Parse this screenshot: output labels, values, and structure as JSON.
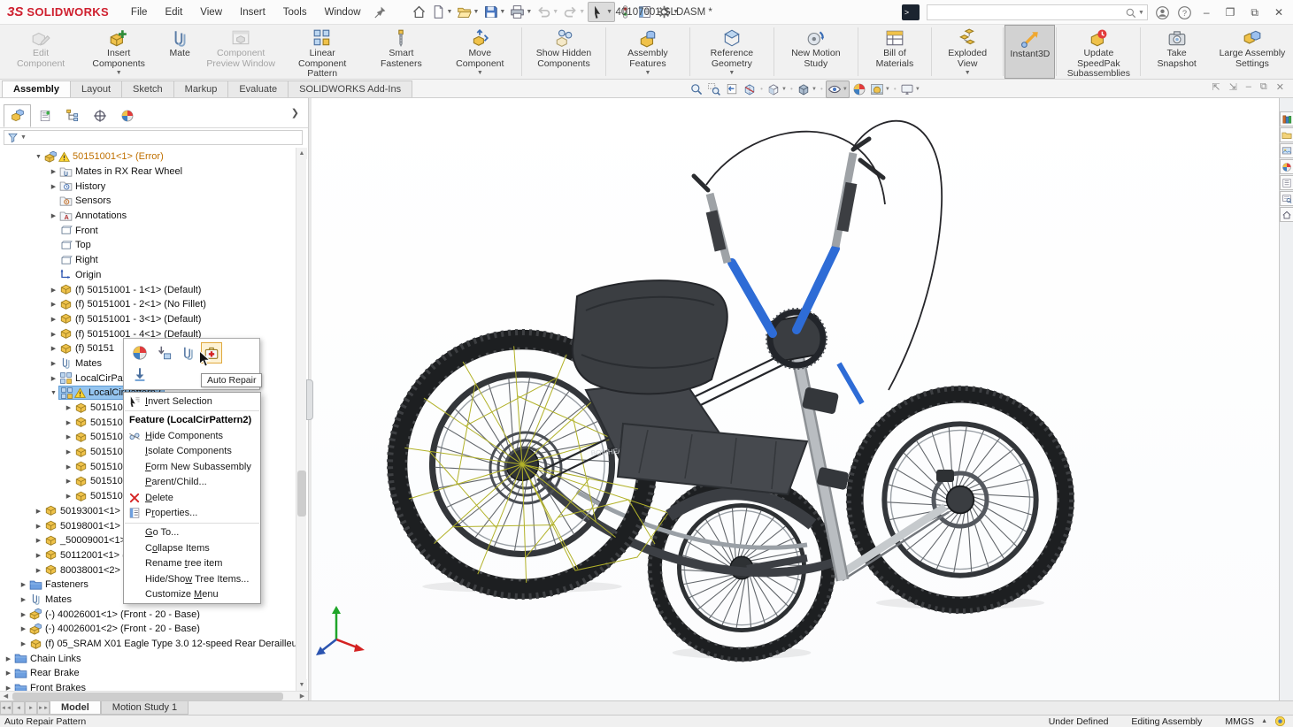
{
  "title_bar": {
    "brand_prefix": "3S",
    "brand": "SOLIDWORKS",
    "menus": [
      "File",
      "Edit",
      "View",
      "Insert",
      "Tools",
      "Window"
    ],
    "quick_access": [
      {
        "name": "home",
        "icon": "home"
      },
      {
        "name": "new-document",
        "icon": "new-doc",
        "caret": true
      },
      {
        "name": "open",
        "icon": "open",
        "caret": true
      },
      {
        "name": "save",
        "icon": "save",
        "caret": true
      },
      {
        "name": "print",
        "icon": "print",
        "caret": true
      },
      {
        "name": "undo",
        "icon": "undo",
        "caret": true,
        "disabled": true
      },
      {
        "name": "redo",
        "icon": "redo",
        "caret": true,
        "disabled": true
      },
      {
        "name": "select",
        "icon": "cursor",
        "caret": true,
        "active": true
      },
      {
        "name": "selection-filter",
        "icon": "pill"
      },
      {
        "name": "task-pane-list",
        "icon": "tasklist"
      },
      {
        "name": "options",
        "icon": "gear",
        "caret": true
      }
    ],
    "document_title": "40107001.SLDASM *",
    "search_placeholder": ""
  },
  "ribbon": {
    "buttons": [
      {
        "label": "Edit Component",
        "icon": "edit-component",
        "disabled": true
      },
      {
        "label": "Insert Components",
        "icon": "insert-components",
        "caret": true
      },
      {
        "label": "Mate",
        "icon": "mate"
      },
      {
        "label": "Component Preview Window",
        "icon": "component-preview",
        "disabled": true
      },
      {
        "label": "Linear Component Pattern",
        "icon": "linear-pattern",
        "caret": true
      },
      {
        "label": "Smart Fasteners",
        "icon": "smart-fasteners"
      },
      {
        "label": "Move Component",
        "icon": "move-component",
        "caret": true
      },
      {
        "label": "Show Hidden Components",
        "icon": "show-hidden",
        "divider": true
      },
      {
        "label": "Assembly Features",
        "icon": "assembly-features",
        "caret": true,
        "divider": true
      },
      {
        "label": "Reference Geometry",
        "icon": "reference-geometry",
        "caret": true,
        "divider": true
      },
      {
        "label": "New Motion Study",
        "icon": "motion-study",
        "divider": true
      },
      {
        "label": "Bill of Materials",
        "icon": "bom",
        "divider": true
      },
      {
        "label": "Exploded View",
        "icon": "exploded-view",
        "caret": true,
        "divider": true
      },
      {
        "label": "Instant3D",
        "icon": "instant3d",
        "active": true,
        "divider": true
      },
      {
        "label": "Update SpeedPak Subassemblies",
        "icon": "speedpak",
        "divider": true
      },
      {
        "label": "Take Snapshot",
        "icon": "snapshot",
        "divider": true
      },
      {
        "label": "Large Assembly Settings",
        "icon": "large-assembly"
      }
    ]
  },
  "command_tabs": {
    "items": [
      "Assembly",
      "Layout",
      "Sketch",
      "Markup",
      "Evaluate",
      "SOLIDWORKS Add-Ins"
    ],
    "active": "Assembly"
  },
  "headsup": {
    "icons": [
      {
        "name": "zoom-to-fit",
        "icon": "zoom-fit"
      },
      {
        "name": "zoom-to-area",
        "icon": "zoom-area"
      },
      {
        "name": "previous-view",
        "icon": "prev-view"
      },
      {
        "name": "section-view",
        "icon": "section"
      },
      {
        "name": "view-orientation",
        "icon": "orientation",
        "caret": true,
        "divider": true
      },
      {
        "name": "display-style",
        "icon": "display-style",
        "caret": true,
        "divider": true
      },
      {
        "name": "hide-show-items",
        "icon": "eye",
        "caret": true,
        "active": true,
        "divider": true
      },
      {
        "name": "edit-appearance",
        "icon": "ball"
      },
      {
        "name": "apply-scene",
        "icon": "scene",
        "caret": true
      },
      {
        "name": "view-settings",
        "icon": "monitor",
        "caret": true,
        "divider": true
      }
    ]
  },
  "doc_controls": [
    "pane-previous",
    "pane-next",
    "minimize",
    "restore",
    "close"
  ],
  "panel": {
    "tabs": [
      {
        "name": "featuremanager-tab",
        "icon": "tab-feature",
        "active": true
      },
      {
        "name": "propertymanager-tab",
        "icon": "tab-property"
      },
      {
        "name": "configurationmanager-tab",
        "icon": "tab-config"
      },
      {
        "name": "dimxpertmanager-tab",
        "icon": "tab-dimxpert"
      },
      {
        "name": "displaymanager-tab",
        "icon": "tab-display"
      }
    ],
    "tree": [
      {
        "label": "50151001<1>  (Error)",
        "level": 2,
        "arrow": "down",
        "icon": "assembly",
        "warning": true,
        "error": true
      },
      {
        "label": "Mates in RX Rear Wheel",
        "level": 3,
        "arrow": "right",
        "icon": "folder-mates"
      },
      {
        "label": "History",
        "level": 3,
        "arrow": "right",
        "icon": "folder-history"
      },
      {
        "label": "Sensors",
        "level": 3,
        "arrow": "none",
        "icon": "folder-sensors"
      },
      {
        "label": "Annotations",
        "level": 3,
        "arrow": "right",
        "icon": "folder-annotations"
      },
      {
        "label": "Front",
        "level": 3,
        "arrow": "none",
        "icon": "plane"
      },
      {
        "label": "Top",
        "level": 3,
        "arrow": "none",
        "icon": "plane"
      },
      {
        "label": "Right",
        "level": 3,
        "arrow": "none",
        "icon": "plane"
      },
      {
        "label": "Origin",
        "level": 3,
        "arrow": "none",
        "icon": "origin"
      },
      {
        "label": "(f) 50151001 - 1<1> (Default)",
        "level": 3,
        "arrow": "right",
        "icon": "part"
      },
      {
        "label": "(f) 50151001 - 2<1> (No Fillet)",
        "level": 3,
        "arrow": "right",
        "icon": "part"
      },
      {
        "label": "(f) 50151001 - 3<1> (Default)",
        "level": 3,
        "arrow": "right",
        "icon": "part"
      },
      {
        "label": "(f) 50151001 - 4<1> (Default)",
        "level": 3,
        "arrow": "right",
        "icon": "part"
      },
      {
        "label": "(f) 50151",
        "level": 3,
        "arrow": "right",
        "icon": "part"
      },
      {
        "label": "Mates",
        "level": 3,
        "arrow": "right",
        "icon": "mates"
      },
      {
        "label": "LocalCirPatt",
        "level": 3,
        "arrow": "right",
        "icon": "pattern"
      },
      {
        "label": "LocalCirPattern2",
        "level": 3,
        "arrow": "down",
        "icon": "pattern",
        "warning": true,
        "selected": true
      },
      {
        "label": "5015100",
        "level": 4,
        "arrow": "right",
        "icon": "part"
      },
      {
        "label": "5015100",
        "level": 4,
        "arrow": "right",
        "icon": "part"
      },
      {
        "label": "5015100",
        "level": 4,
        "arrow": "right",
        "icon": "part"
      },
      {
        "label": "5015100",
        "level": 4,
        "arrow": "right",
        "icon": "part"
      },
      {
        "label": "5015100",
        "level": 4,
        "arrow": "right",
        "icon": "part"
      },
      {
        "label": "5015100",
        "level": 4,
        "arrow": "right",
        "icon": "part"
      },
      {
        "label": "5015100",
        "level": 4,
        "arrow": "right",
        "icon": "part"
      },
      {
        "label": "50193001<1> ->",
        "level": 2,
        "arrow": "right",
        "icon": "part"
      },
      {
        "label": "50198001<1> (R",
        "level": 2,
        "arrow": "right",
        "icon": "part"
      },
      {
        "label": "_50009001<1> (E",
        "level": 2,
        "arrow": "right",
        "icon": "part"
      },
      {
        "label": "50112001<1> (C",
        "level": 2,
        "arrow": "right",
        "icon": "part"
      },
      {
        "label": "80038001<2> (Li",
        "level": 2,
        "arrow": "right",
        "icon": "part"
      },
      {
        "label": "Fasteners",
        "level": 1,
        "arrow": "right",
        "icon": "folder"
      },
      {
        "label": "Mates",
        "level": 1,
        "arrow": "right",
        "icon": "mates"
      },
      {
        "label": "(-) 40026001<1>  (Front - 20  - Base)",
        "level": 1,
        "arrow": "right",
        "icon": "assembly"
      },
      {
        "label": "(-) 40026001<2>  (Front - 20  - Base)",
        "level": 1,
        "arrow": "right",
        "icon": "assembly"
      },
      {
        "label": "(f) 05_SRAM X01 Eagle Type 3.0 12-speed Rear Derailleur<2>  (Default)",
        "level": 1,
        "arrow": "right",
        "icon": "part"
      },
      {
        "label": "Chain Links",
        "level": 0,
        "arrow": "right",
        "icon": "folder"
      },
      {
        "label": "Rear Brake",
        "level": 0,
        "arrow": "right",
        "icon": "folder"
      },
      {
        "label": "Front Brakes",
        "level": 0,
        "arrow": "right",
        "icon": "folder"
      }
    ]
  },
  "context_toolbar": {
    "row1": [
      {
        "name": "edit-feature",
        "icon": "c-edit"
      },
      {
        "name": "suppress",
        "icon": "c-suppress"
      },
      {
        "name": "mate",
        "icon": "c-clip"
      },
      {
        "name": "auto-repair",
        "icon": "c-repair",
        "hovered": true
      }
    ],
    "row2": [
      {
        "name": "insert-below",
        "icon": "c-arrow"
      }
    ],
    "tooltip": "Auto Repair"
  },
  "context_menu": {
    "items": [
      {
        "type": "item",
        "icon": "m-invert",
        "label": "Invert Selection",
        "accel": "I"
      },
      {
        "type": "separator"
      },
      {
        "type": "header",
        "label": "Feature (LocalCirPattern2)"
      },
      {
        "type": "item",
        "icon": "m-hide",
        "label": "Hide Components",
        "accel": "H"
      },
      {
        "type": "item",
        "label": "Isolate Components",
        "accel": "I"
      },
      {
        "type": "item",
        "label": "Form New Subassembly",
        "accel": "F"
      },
      {
        "type": "item",
        "label": "Parent/Child...",
        "accel": "P"
      },
      {
        "type": "item",
        "icon": "m-delete",
        "label": "Delete",
        "accel": "D"
      },
      {
        "type": "item",
        "icon": "m-props",
        "label": "Properties...",
        "accel": "r"
      },
      {
        "type": "separator"
      },
      {
        "type": "item",
        "label": "Go To...",
        "accel": "G"
      },
      {
        "type": "item",
        "label": "Collapse Items",
        "accel": "o"
      },
      {
        "type": "item",
        "label": "Rename tree item",
        "accel": "t"
      },
      {
        "type": "item",
        "label": "Hide/Show Tree Items...",
        "accel": "w"
      },
      {
        "type": "item",
        "label": "Customize Menu",
        "accel": "M"
      }
    ]
  },
  "task_pane": [
    {
      "name": "design-library",
      "icon": "tp-library"
    },
    {
      "name": "file-explorer",
      "icon": "tp-folder"
    },
    {
      "name": "view-palette",
      "icon": "tp-palette"
    },
    {
      "name": "appearances-scenes",
      "icon": "tp-ball"
    },
    {
      "name": "custom-properties",
      "icon": "tp-props"
    },
    {
      "name": "solidworks-forum",
      "icon": "tp-board"
    },
    {
      "name": "solidworks-resources",
      "icon": "tp-home"
    }
  ],
  "model_tabs": {
    "tabs": [
      {
        "label": "Model",
        "active": true
      },
      {
        "label": "Motion Study 1",
        "active": false
      }
    ]
  },
  "status_bar": {
    "message": "Auto Repair Pattern",
    "define_state": "Under Defined",
    "mode": "Editing Assembly",
    "units": "MMGS"
  },
  "graphics": {
    "frame_brand": "BOWHEAD"
  }
}
